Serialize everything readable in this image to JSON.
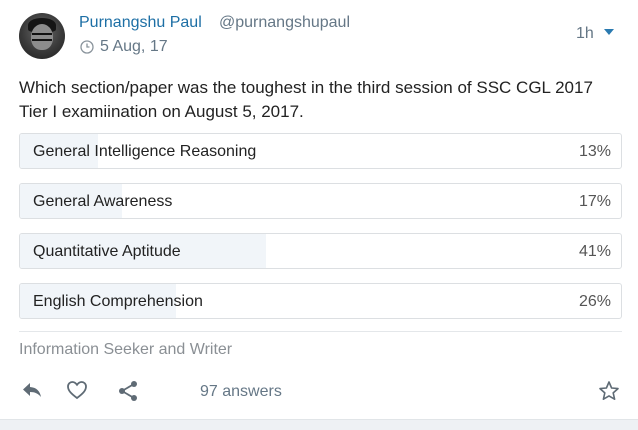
{
  "author": {
    "name": "Purnangshu Paul",
    "handle": "@purnangshupaul",
    "date": "5 Aug, 17",
    "time_ago": "1h"
  },
  "question": "Which section/paper was the toughest in the third session of SSC CGL 2017 Tier I examiination on August 5, 2017.",
  "poll": {
    "options": [
      {
        "label": "General Intelligence Reasoning",
        "percent_text": "13%",
        "percent": 13
      },
      {
        "label": "General Awareness",
        "percent_text": "17%",
        "percent": 17
      },
      {
        "label": "Quantitative Aptitude",
        "percent_text": "41%",
        "percent": 41
      },
      {
        "label": "English Comprehension",
        "percent_text": "26%",
        "percent": 26
      }
    ]
  },
  "footer": {
    "bio": "Information Seeker and Writer",
    "answers": "97 answers"
  },
  "icons": {
    "clock": "clock-icon",
    "caret": "chevron-down-icon",
    "reply": "reply-icon",
    "like": "heart-icon",
    "share": "share-icon",
    "bookmark": "star-icon"
  },
  "colors": {
    "link": "#1d6fa5",
    "muted": "#657786",
    "bar_fill": "#f1f5f9",
    "border": "#dcdfe2"
  }
}
